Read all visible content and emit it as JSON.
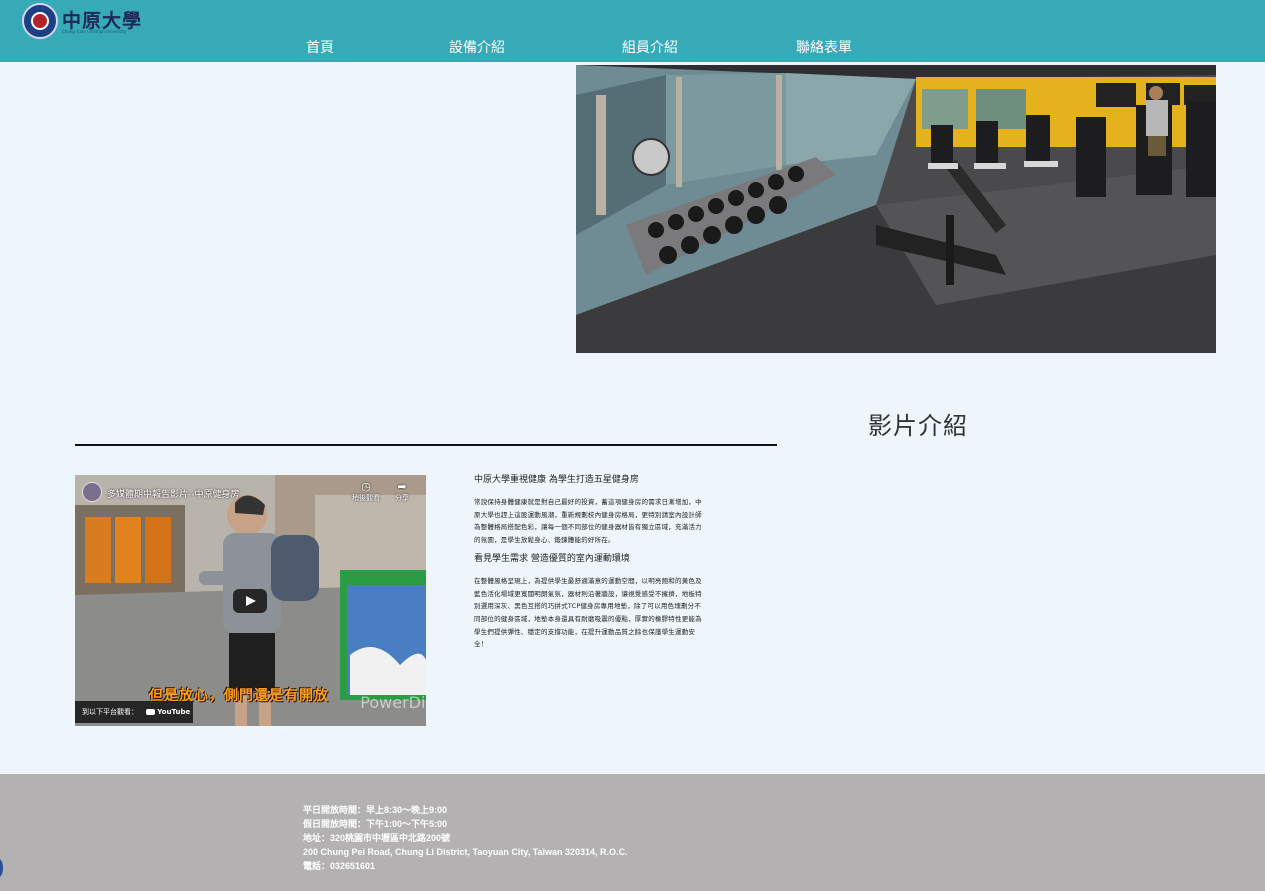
{
  "header": {
    "logo_alt": "中原大學",
    "logo_text": "中原大學",
    "logo_subtext": "Chung Yuan Christian University",
    "nav": [
      {
        "label": "首頁"
      },
      {
        "label": "設備介紹"
      },
      {
        "label": "組員介紹"
      },
      {
        "label": "聯絡表單"
      }
    ],
    "colors": {
      "bar": "#36aab7"
    }
  },
  "hero_photo": {
    "alt": "健身房內部照片",
    "icon": "gym-photo"
  },
  "section": {
    "title": "影片介紹"
  },
  "video": {
    "title": "多媒體期中報告影片--中原健身房",
    "watch_later": "稍後觀看",
    "share": "分享",
    "caption": "但是放心，側門還是有開放",
    "watermark": "PowerDir",
    "watch_on": "到以下平台觀看：",
    "platform": "YouTube"
  },
  "article": {
    "heading1": "中原大學重視健康 為學生打造五星健身房",
    "para1": "常說保持身體健康就是對自己最好的投資，蓄這項健身房的需求日漸增加，中原大學也趕上這股運動風潮，重新規劃校內健身房格局，更特別請室內設計師為整體格局搭配色彩，讓每一個不同部位的健身器材皆有獨立區域，充滿活力的氛圍，是學生放鬆身心、鍛鍊體能的好所在。",
    "heading2": "看見學生需求 營造優質的室內運動環境",
    "para2": "在整體風格呈現上，為提供學生最舒適滿意的運動空間，以明亮飽和的黃色及藍色活化場域更寬闊明朗氣氛，器材則沿著牆設，讓視覺感受不擁擠，地板特別選用深灰、黑色互搭的巧拼式TCP健身房專用地墊，除了可以用色塊劃分不同部位的健身區域，地墊本身還具有耐磨吸震的優點，厚實的橡膠特性更能為學生們提供彈性、穩定的支撐功能，在提升運動品質之餘也保護學生運動安全！"
  },
  "footer": {
    "weekday_hours": "平日開放時間：早上8:30～晚上9:00",
    "holiday_hours": "假日開放時間：下午1:00～下午5:00",
    "address_zh": "地址：320桃園市中壢區中北路200號",
    "address_en": "200 Chung Pei Road, Chung Li District, Taoyuan City, Taiwan 320314, R.O.C.",
    "phone": "電話：032651601",
    "colors": {
      "background": "#b3b1b1"
    }
  }
}
